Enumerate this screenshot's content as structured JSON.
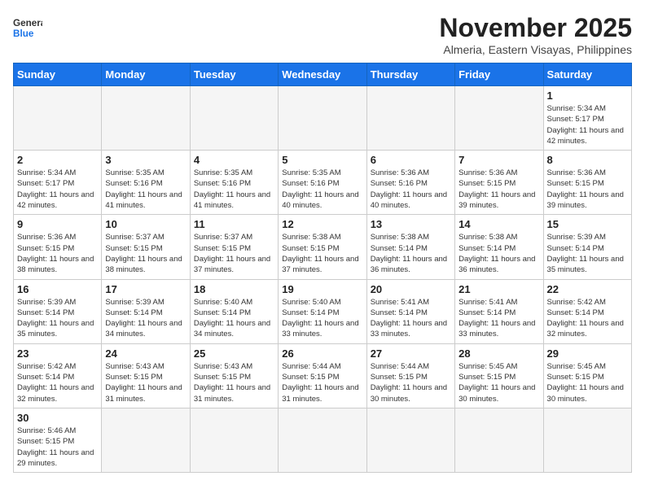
{
  "header": {
    "logo_general": "General",
    "logo_blue": "Blue",
    "title": "November 2025",
    "subtitle": "Almeria, Eastern Visayas, Philippines"
  },
  "days_of_week": [
    "Sunday",
    "Monday",
    "Tuesday",
    "Wednesday",
    "Thursday",
    "Friday",
    "Saturday"
  ],
  "weeks": [
    [
      {
        "day": "",
        "empty": true
      },
      {
        "day": "",
        "empty": true
      },
      {
        "day": "",
        "empty": true
      },
      {
        "day": "",
        "empty": true
      },
      {
        "day": "",
        "empty": true
      },
      {
        "day": "",
        "empty": true
      },
      {
        "day": "1",
        "sunrise": "5:34 AM",
        "sunset": "5:17 PM",
        "daylight": "11 hours and 42 minutes."
      }
    ],
    [
      {
        "day": "2",
        "sunrise": "5:34 AM",
        "sunset": "5:17 PM",
        "daylight": "11 hours and 42 minutes."
      },
      {
        "day": "3",
        "sunrise": "5:35 AM",
        "sunset": "5:16 PM",
        "daylight": "11 hours and 41 minutes."
      },
      {
        "day": "4",
        "sunrise": "5:35 AM",
        "sunset": "5:16 PM",
        "daylight": "11 hours and 41 minutes."
      },
      {
        "day": "5",
        "sunrise": "5:35 AM",
        "sunset": "5:16 PM",
        "daylight": "11 hours and 40 minutes."
      },
      {
        "day": "6",
        "sunrise": "5:36 AM",
        "sunset": "5:16 PM",
        "daylight": "11 hours and 40 minutes."
      },
      {
        "day": "7",
        "sunrise": "5:36 AM",
        "sunset": "5:15 PM",
        "daylight": "11 hours and 39 minutes."
      },
      {
        "day": "8",
        "sunrise": "5:36 AM",
        "sunset": "5:15 PM",
        "daylight": "11 hours and 39 minutes."
      }
    ],
    [
      {
        "day": "9",
        "sunrise": "5:36 AM",
        "sunset": "5:15 PM",
        "daylight": "11 hours and 38 minutes."
      },
      {
        "day": "10",
        "sunrise": "5:37 AM",
        "sunset": "5:15 PM",
        "daylight": "11 hours and 38 minutes."
      },
      {
        "day": "11",
        "sunrise": "5:37 AM",
        "sunset": "5:15 PM",
        "daylight": "11 hours and 37 minutes."
      },
      {
        "day": "12",
        "sunrise": "5:38 AM",
        "sunset": "5:15 PM",
        "daylight": "11 hours and 37 minutes."
      },
      {
        "day": "13",
        "sunrise": "5:38 AM",
        "sunset": "5:14 PM",
        "daylight": "11 hours and 36 minutes."
      },
      {
        "day": "14",
        "sunrise": "5:38 AM",
        "sunset": "5:14 PM",
        "daylight": "11 hours and 36 minutes."
      },
      {
        "day": "15",
        "sunrise": "5:39 AM",
        "sunset": "5:14 PM",
        "daylight": "11 hours and 35 minutes."
      }
    ],
    [
      {
        "day": "16",
        "sunrise": "5:39 AM",
        "sunset": "5:14 PM",
        "daylight": "11 hours and 35 minutes."
      },
      {
        "day": "17",
        "sunrise": "5:39 AM",
        "sunset": "5:14 PM",
        "daylight": "11 hours and 34 minutes."
      },
      {
        "day": "18",
        "sunrise": "5:40 AM",
        "sunset": "5:14 PM",
        "daylight": "11 hours and 34 minutes."
      },
      {
        "day": "19",
        "sunrise": "5:40 AM",
        "sunset": "5:14 PM",
        "daylight": "11 hours and 33 minutes."
      },
      {
        "day": "20",
        "sunrise": "5:41 AM",
        "sunset": "5:14 PM",
        "daylight": "11 hours and 33 minutes."
      },
      {
        "day": "21",
        "sunrise": "5:41 AM",
        "sunset": "5:14 PM",
        "daylight": "11 hours and 33 minutes."
      },
      {
        "day": "22",
        "sunrise": "5:42 AM",
        "sunset": "5:14 PM",
        "daylight": "11 hours and 32 minutes."
      }
    ],
    [
      {
        "day": "23",
        "sunrise": "5:42 AM",
        "sunset": "5:14 PM",
        "daylight": "11 hours and 32 minutes."
      },
      {
        "day": "24",
        "sunrise": "5:43 AM",
        "sunset": "5:15 PM",
        "daylight": "11 hours and 31 minutes."
      },
      {
        "day": "25",
        "sunrise": "5:43 AM",
        "sunset": "5:15 PM",
        "daylight": "11 hours and 31 minutes."
      },
      {
        "day": "26",
        "sunrise": "5:44 AM",
        "sunset": "5:15 PM",
        "daylight": "11 hours and 31 minutes."
      },
      {
        "day": "27",
        "sunrise": "5:44 AM",
        "sunset": "5:15 PM",
        "daylight": "11 hours and 30 minutes."
      },
      {
        "day": "28",
        "sunrise": "5:45 AM",
        "sunset": "5:15 PM",
        "daylight": "11 hours and 30 minutes."
      },
      {
        "day": "29",
        "sunrise": "5:45 AM",
        "sunset": "5:15 PM",
        "daylight": "11 hours and 30 minutes."
      }
    ],
    [
      {
        "day": "30",
        "sunrise": "5:46 AM",
        "sunset": "5:15 PM",
        "daylight": "11 hours and 29 minutes."
      },
      {
        "day": "",
        "empty": true
      },
      {
        "day": "",
        "empty": true
      },
      {
        "day": "",
        "empty": true
      },
      {
        "day": "",
        "empty": true
      },
      {
        "day": "",
        "empty": true
      },
      {
        "day": "",
        "empty": true
      }
    ]
  ]
}
